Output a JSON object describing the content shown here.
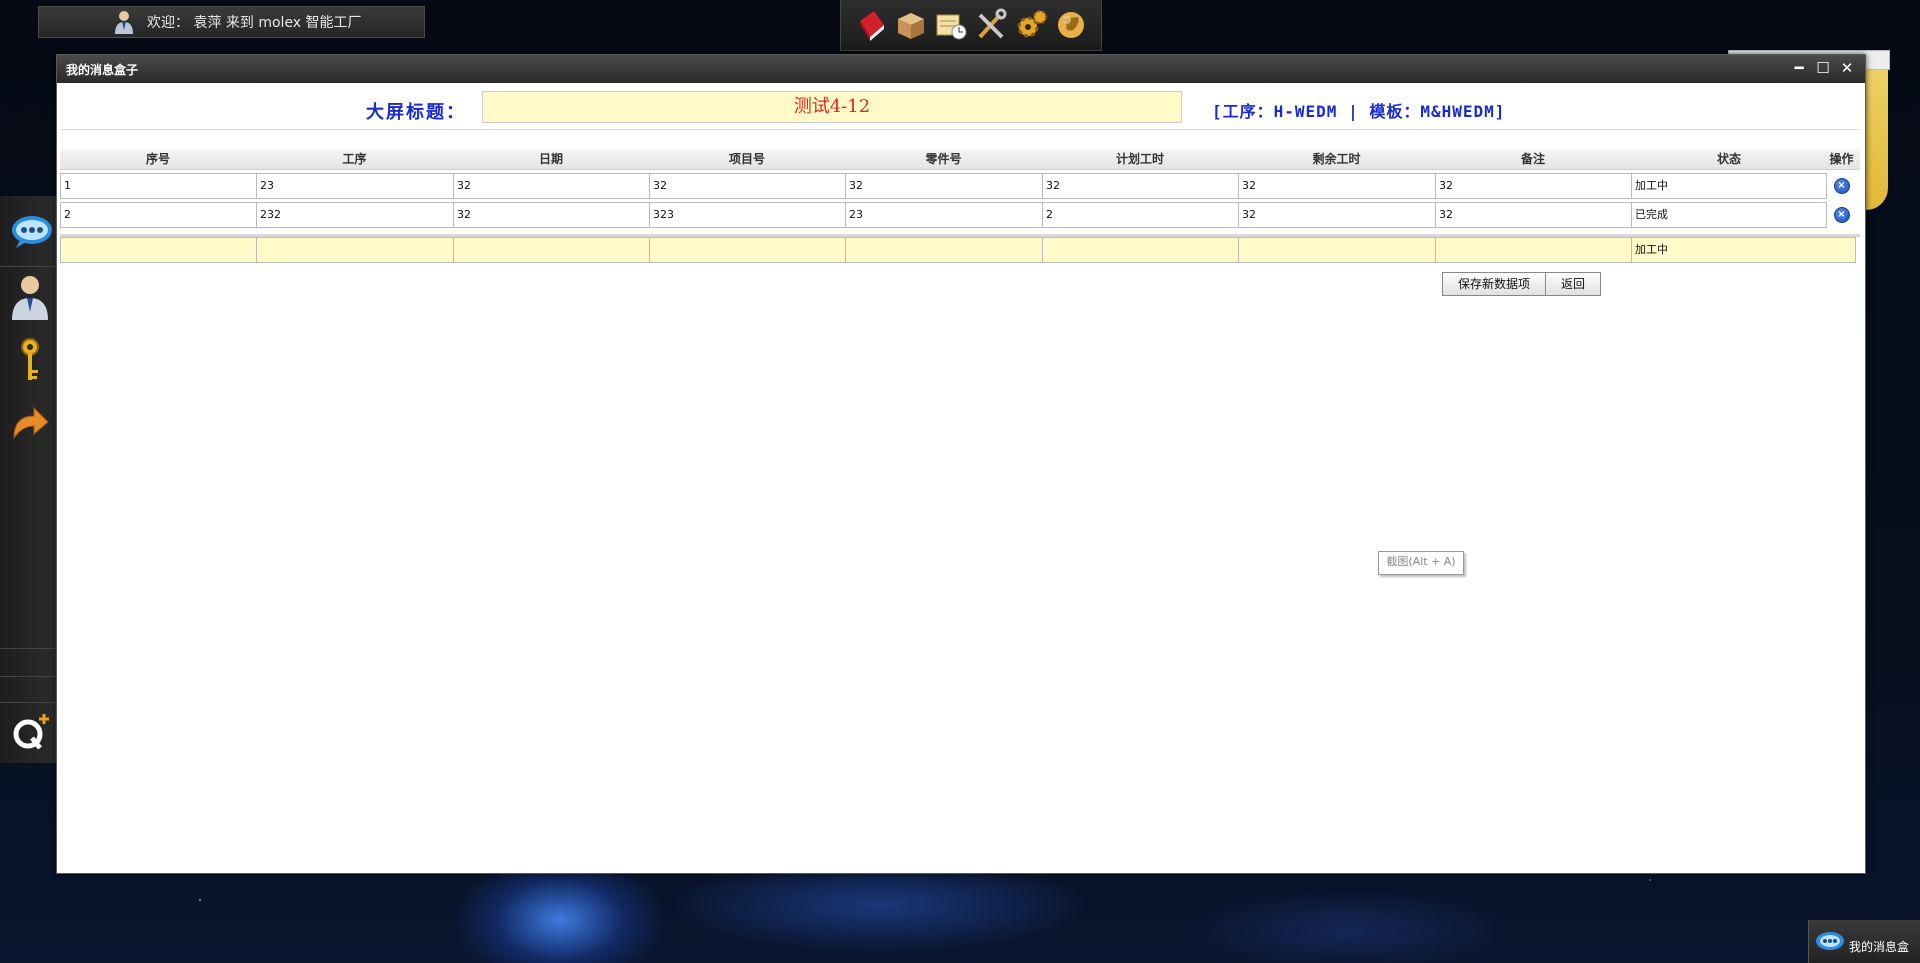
{
  "welcome": {
    "text": "欢迎：  袁萍 来到 molex 智能工厂"
  },
  "top_dock": {
    "icons": [
      "book-icon",
      "package-icon",
      "schedule-icon",
      "tools-icon",
      "gears-icon",
      "globe-icon"
    ]
  },
  "left_dock": {
    "icons": [
      "chat-icon",
      "user-icon",
      "key-icon",
      "redo-arrow-icon",
      "qq-plus-icon"
    ]
  },
  "window": {
    "title": "我的消息盒子",
    "controls": {
      "minimize": "━",
      "maximize": "☐",
      "close": "✕"
    }
  },
  "header": {
    "label": "大屏标题：",
    "title_value": "测试4-12",
    "proc_info": "[工序：H-WEDM | 模板：M&HWEDM]"
  },
  "table": {
    "columns": [
      "序号",
      "工序",
      "日期",
      "项目号",
      "零件号",
      "计划工时",
      "剩余工时",
      "备注",
      "状态",
      "操作"
    ],
    "rows": [
      [
        "1",
        "23",
        "32",
        "32",
        "32",
        "32",
        "32",
        "32",
        "加工中"
      ],
      [
        "2",
        "232",
        "32",
        "323",
        "23",
        "2",
        "32",
        "32",
        "已完成"
      ]
    ],
    "new_row": {
      "status_selected": "加工中"
    },
    "delete_symbol": "×"
  },
  "buttons": {
    "save": "保存新数据项",
    "back": "返回"
  },
  "tooltip": "截图(Alt + A)",
  "tray": {
    "label": "我的消息盒"
  },
  "colors": {
    "accent_blue": "#1a2bd0",
    "title_red": "#e0281c",
    "input_yellow": "#fffac8"
  }
}
